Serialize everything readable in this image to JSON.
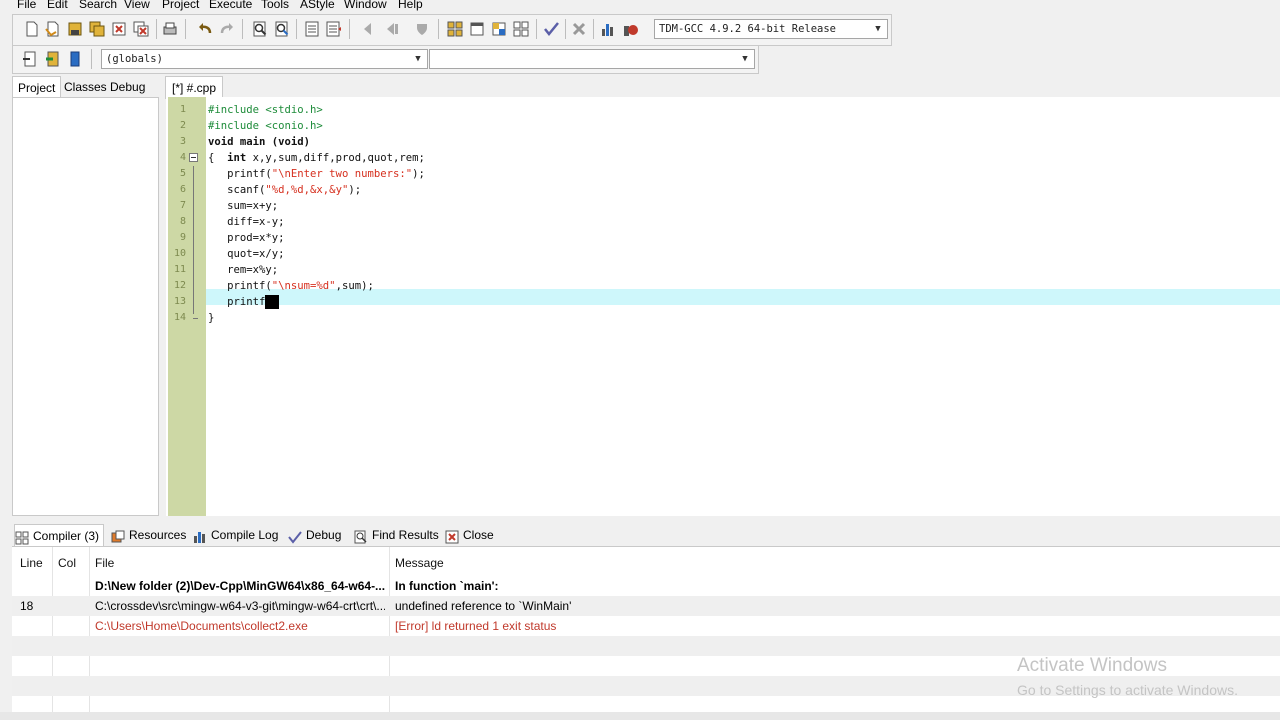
{
  "menu": [
    "File",
    "Edit",
    "Search",
    "View",
    "Project",
    "Execute",
    "Tools",
    "AStyle",
    "Window",
    "Help"
  ],
  "toolbar": {
    "icons": [
      "new-file-icon",
      "open-icon",
      "save-icon",
      "save-all-icon",
      "close-icon",
      "close-all-icon",
      "print-icon",
      "undo-icon",
      "redo-icon",
      "find-icon",
      "replace-icon",
      "indent-icon",
      "unindent-icon",
      "compile-icon",
      "run-icon",
      "compile-run-icon",
      "rebuild-icon",
      "new-project-icon",
      "project-options-icon",
      "insert-icon",
      "toggle-bookmark-icon",
      "check-icon",
      "stop-icon",
      "chart-icon",
      "profile-icon"
    ],
    "compiler": "TDM-GCC 4.9.2 64-bit Release",
    "scope": "(globals)",
    "function": ""
  },
  "left_tabs": [
    "Project",
    "Classes",
    "Debug"
  ],
  "editor": {
    "tab": "[*] #.cpp",
    "lines": [
      [
        {
          "t": "#include <stdio.h>",
          "c": "pp"
        }
      ],
      [
        {
          "t": "#include <conio.h>",
          "c": "pp"
        }
      ],
      [
        {
          "t": "void main (void)",
          "c": "kw"
        }
      ],
      [
        {
          "t": "{  ",
          "c": ""
        },
        {
          "t": "int",
          "c": "kw"
        },
        {
          "t": " x,y,sum,diff,prod,quot,rem;",
          "c": ""
        }
      ],
      [
        {
          "t": "   printf(",
          "c": ""
        },
        {
          "t": "\"\\nEnter two numbers:\"",
          "c": "st"
        },
        {
          "t": ");",
          "c": ""
        }
      ],
      [
        {
          "t": "   scanf(",
          "c": ""
        },
        {
          "t": "\"%d,%d,&x,&y\"",
          "c": "st"
        },
        {
          "t": ");",
          "c": ""
        }
      ],
      [
        {
          "t": "   sum=x+y;",
          "c": ""
        }
      ],
      [
        {
          "t": "   diff=x-y;",
          "c": ""
        }
      ],
      [
        {
          "t": "   prod=x*y;",
          "c": ""
        }
      ],
      [
        {
          "t": "   quot=x/y;",
          "c": ""
        }
      ],
      [
        {
          "t": "   rem=x%y;",
          "c": ""
        }
      ],
      [
        {
          "t": "   printf(",
          "c": ""
        },
        {
          "t": "\"\\nsum=%d\"",
          "c": "st"
        },
        {
          "t": ",sum);",
          "c": ""
        }
      ],
      [
        {
          "t": "   printf",
          "c": ""
        }
      ],
      [
        {
          "t": "}",
          "c": ""
        }
      ]
    ],
    "line_numbers": [
      "1",
      "2",
      "3",
      "4",
      "5",
      "6",
      "7",
      "8",
      "9",
      "10",
      "11",
      "12",
      "13",
      "14"
    ]
  },
  "bottom_tabs": [
    "Compiler (3)",
    "Resources",
    "Compile Log",
    "Debug",
    "Find Results",
    "Close"
  ],
  "messages": {
    "headers": {
      "line": "Line",
      "col": "Col",
      "file": "File",
      "message": "Message"
    },
    "rows": [
      {
        "line": "",
        "col": "",
        "file": "D:\\New folder (2)\\Dev-Cpp\\MinGW64\\x86_64-w64-...",
        "message": "In function `main':",
        "style": "bold"
      },
      {
        "line": "18",
        "col": "",
        "file": "C:\\crossdev\\src\\mingw-w64-v3-git\\mingw-w64-crt\\crt\\...",
        "message": "undefined reference to `WinMain'",
        "style": ""
      },
      {
        "line": "",
        "col": "",
        "file": "C:\\Users\\Home\\Documents\\collect2.exe",
        "message": "[Error] ld returned 1 exit status",
        "style": "err"
      }
    ]
  },
  "watermark": {
    "title": "Activate Windows",
    "subtitle": "Go to Settings to activate Windows."
  }
}
